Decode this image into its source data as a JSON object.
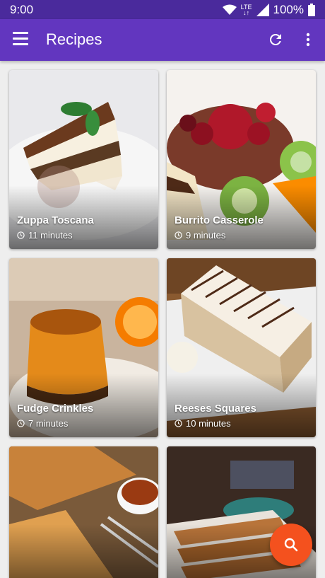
{
  "status_bar": {
    "time": "9:00",
    "network": "LTE",
    "battery": "100%",
    "icons": [
      "wifi-icon",
      "lte-icon",
      "signal-icon",
      "battery-icon"
    ]
  },
  "app_bar": {
    "title": "Recipes",
    "color": "#6236bf",
    "icons": [
      "menu-icon",
      "refresh-icon",
      "more-vert-icon"
    ]
  },
  "recipes": [
    {
      "name": "Zuppa Toscana",
      "time": "11 minutes"
    },
    {
      "name": "Burrito Casserole",
      "time": "9 minutes"
    },
    {
      "name": "Fudge Crinkles",
      "time": "7 minutes"
    },
    {
      "name": "Reeses Squares",
      "time": "10 minutes"
    },
    {
      "name": "",
      "time": ""
    },
    {
      "name": "",
      "time": ""
    }
  ],
  "fab": {
    "icon": "search-icon",
    "color": "#f4511e"
  }
}
